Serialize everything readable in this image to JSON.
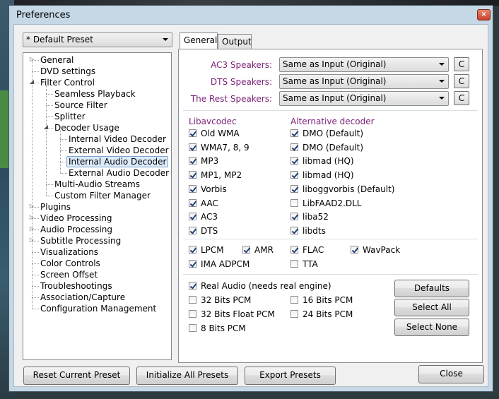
{
  "window": {
    "title": "Preferences",
    "close_glyph": "×"
  },
  "preset": {
    "selected": "* Default Preset"
  },
  "tree": [
    {
      "label": "General",
      "depth": 0,
      "toggle": "collapsed"
    },
    {
      "label": "DVD settings",
      "depth": 0,
      "toggle": "none"
    },
    {
      "label": "Filter Control",
      "depth": 0,
      "toggle": "expanded"
    },
    {
      "label": "Seamless Playback",
      "depth": 1,
      "toggle": "none"
    },
    {
      "label": "Source Filter",
      "depth": 1,
      "toggle": "none"
    },
    {
      "label": "Splitter",
      "depth": 1,
      "toggle": "none"
    },
    {
      "label": "Decoder Usage",
      "depth": 1,
      "toggle": "expanded"
    },
    {
      "label": "Internal Video Decoder",
      "depth": 2,
      "toggle": "none"
    },
    {
      "label": "External Video Decoder",
      "depth": 2,
      "toggle": "none"
    },
    {
      "label": "Internal Audio Decoder",
      "depth": 2,
      "toggle": "none",
      "selected": true
    },
    {
      "label": "External Audio Decoder",
      "depth": 2,
      "toggle": "none"
    },
    {
      "label": "Multi-Audio Streams",
      "depth": 1,
      "toggle": "none"
    },
    {
      "label": "Custom Filter Manager",
      "depth": 1,
      "toggle": "none"
    },
    {
      "label": "Plugins",
      "depth": 0,
      "toggle": "collapsed"
    },
    {
      "label": "Video Processing",
      "depth": 0,
      "toggle": "collapsed"
    },
    {
      "label": "Audio Processing",
      "depth": 0,
      "toggle": "collapsed"
    },
    {
      "label": "Subtitle Processing",
      "depth": 0,
      "toggle": "collapsed"
    },
    {
      "label": "Visualizations",
      "depth": 0,
      "toggle": "none"
    },
    {
      "label": "Color Controls",
      "depth": 0,
      "toggle": "none"
    },
    {
      "label": "Screen Offset",
      "depth": 0,
      "toggle": "none"
    },
    {
      "label": "Troubleshootings",
      "depth": 0,
      "toggle": "none"
    },
    {
      "label": "Association/Capture",
      "depth": 0,
      "toggle": "none"
    },
    {
      "label": "Configuration Management",
      "depth": 0,
      "toggle": "none"
    }
  ],
  "tabs": [
    {
      "label": "General",
      "active": true
    },
    {
      "label": "Output",
      "active": false
    }
  ],
  "speakers": [
    {
      "label": "AC3 Speakers:",
      "value": "Same as Input (Original)",
      "button": "C"
    },
    {
      "label": "DTS Speakers:",
      "value": "Same as Input (Original)",
      "button": "C"
    },
    {
      "label": "The Rest Speakers:",
      "value": "Same as Input (Original)",
      "button": "C"
    }
  ],
  "columns": {
    "left": "Libavcodec",
    "right": "Alternative decoder"
  },
  "codecs": [
    {
      "name": "Old WMA",
      "checked": true,
      "alt": "DMO (Default)",
      "alt_checked": true
    },
    {
      "name": "WMA7, 8, 9",
      "checked": true,
      "alt": "DMO (Default)",
      "alt_checked": true
    },
    {
      "name": "MP3",
      "checked": true,
      "alt": "libmad (HQ)",
      "alt_checked": true
    },
    {
      "name": "MP1, MP2",
      "checked": true,
      "alt": "libmad (HQ)",
      "alt_checked": true
    },
    {
      "name": "Vorbis",
      "checked": true,
      "alt": "liboggvorbis (Default)",
      "alt_checked": true
    },
    {
      "name": "AAC",
      "checked": true,
      "alt": "LibFAAD2.DLL",
      "alt_checked": false
    },
    {
      "name": "AC3",
      "checked": true,
      "alt": "liba52",
      "alt_checked": true
    },
    {
      "name": "DTS",
      "checked": true,
      "alt": "libdts",
      "alt_checked": true
    }
  ],
  "extra": [
    {
      "name": "LPCM",
      "checked": true
    },
    {
      "name": "AMR",
      "checked": true
    },
    {
      "name": "FLAC",
      "checked": true
    },
    {
      "name": "WavPack",
      "checked": true
    },
    {
      "name": "IMA ADPCM",
      "checked": true
    },
    {
      "name": "TTA",
      "checked": false
    }
  ],
  "output": {
    "real_audio": {
      "name": "Real Audio (needs real engine)",
      "checked": true
    },
    "pcm": [
      {
        "name": "32 Bits PCM",
        "checked": false
      },
      {
        "name": "16 Bits PCM",
        "checked": false
      },
      {
        "name": "32 Bits Float PCM",
        "checked": false
      },
      {
        "name": "24 Bits PCM",
        "checked": false
      },
      {
        "name": "8 Bits PCM",
        "checked": false
      }
    ]
  },
  "side_buttons": {
    "defaults": "Defaults",
    "select_all": "Select All",
    "select_none": "Select None"
  },
  "footer": {
    "reset": "Reset Current Preset",
    "init": "Initialize All Presets",
    "export": "Export Presets",
    "close": "Close"
  }
}
